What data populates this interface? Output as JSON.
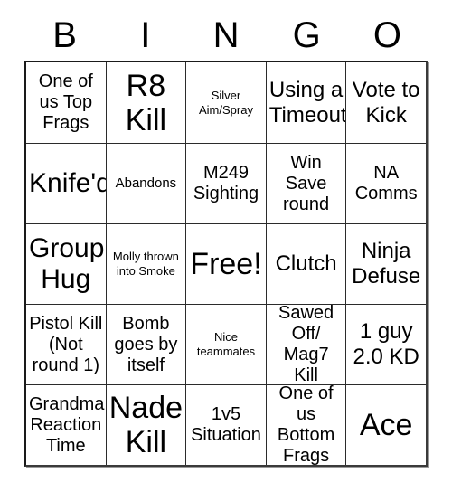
{
  "card": {
    "title": "BINGO",
    "headers": [
      "B",
      "I",
      "N",
      "G",
      "O"
    ],
    "rows": [
      [
        {
          "text": "One of us Top Frags",
          "size": "md"
        },
        {
          "text": "R8 Kill",
          "size": "xxl"
        },
        {
          "text": "Silver Aim/Spray",
          "size": "xs"
        },
        {
          "text": "Using a Timeout",
          "size": "lg"
        },
        {
          "text": "Vote to Kick",
          "size": "lg"
        }
      ],
      [
        {
          "text": "Knife'd",
          "size": "xl"
        },
        {
          "text": "Abandons",
          "size": "sm"
        },
        {
          "text": "M249 Sighting",
          "size": "md"
        },
        {
          "text": "Win Save round",
          "size": "md"
        },
        {
          "text": "NA Comms",
          "size": "md"
        }
      ],
      [
        {
          "text": "Group Hug",
          "size": "xl"
        },
        {
          "text": "Molly thrown into Smoke",
          "size": "xs"
        },
        {
          "text": "Free!",
          "size": "xxl"
        },
        {
          "text": "Clutch",
          "size": "lg"
        },
        {
          "text": "Ninja Defuse",
          "size": "lg"
        }
      ],
      [
        {
          "text": "Pistol Kill (Not round 1)",
          "size": "md"
        },
        {
          "text": "Bomb goes by itself",
          "size": "md"
        },
        {
          "text": "Nice teammates",
          "size": "xs"
        },
        {
          "text": "Sawed Off/ Mag7 Kill",
          "size": "md"
        },
        {
          "text": "1 guy 2.0 KD",
          "size": "lg"
        }
      ],
      [
        {
          "text": "Grandma Reaction Time",
          "size": "md"
        },
        {
          "text": "Nade Kill",
          "size": "xxl"
        },
        {
          "text": "1v5 Situation",
          "size": "md"
        },
        {
          "text": "One of us Bottom Frags",
          "size": "md"
        },
        {
          "text": "Ace",
          "size": "xxl"
        }
      ]
    ]
  },
  "colors": {
    "background": "#ffffff",
    "text": "#000000",
    "grid_line": "#2b2b2b",
    "outer_border": "#1a1a1a",
    "shadow": "#9a9a9a"
  }
}
